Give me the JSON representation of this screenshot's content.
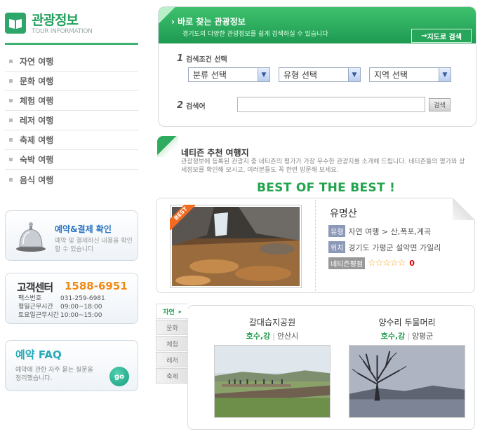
{
  "logo": {
    "title": "관광정보",
    "subtitle": "TOUR INFORMATION",
    "icon": "book-icon"
  },
  "side_menu": [
    {
      "label": "자연 여행"
    },
    {
      "label": "문화 여행"
    },
    {
      "label": "체험 여행"
    },
    {
      "label": "레저 여행"
    },
    {
      "label": "축제 여행"
    },
    {
      "label": "숙박 여행"
    },
    {
      "label": "음식 여행"
    }
  ],
  "reservation": {
    "title": "예약&결제 확인",
    "desc": "예약 및 결제하신 내용을 확인할 수 있습니다",
    "icon": "bell-icon"
  },
  "customer_center": {
    "title": "고객센터",
    "phone": "1588-6951",
    "lines": [
      {
        "key": "팩스번호",
        "value": "031-259-6981"
      },
      {
        "key": "평일근무시간",
        "value": "09:00~18:00"
      },
      {
        "key": "토요일근무시간",
        "value": "10:00~15:00"
      }
    ]
  },
  "faq": {
    "title": "예약 FAQ",
    "desc": "예약에 관한 자주 묻는 질문을 정리했습니다.",
    "go_label": "go"
  },
  "search": {
    "title": "바로 찾는 관광정보",
    "subtitle": "경기도의 다양한 관광정보를 쉽게 검색하실 수 있습니다",
    "map_button": "지도로 검색",
    "step1_num": "1",
    "step1_label": "검색조건 선택",
    "step2_num": "2",
    "step2_label": "검색어",
    "selects": [
      "분류 선택",
      "유형 선택",
      "지역 선택"
    ],
    "keyword_value": "",
    "search_button": "검색"
  },
  "recommend": {
    "title": "네티즌 추천 여행지",
    "desc": "관광정보에 등록된 관광지 중 네티즌의 평가가 가장 우수한 관광지를 소개해 드립니다. 네티즌들의 평가와 상세정보를 확인해 보시고, 여러분들도 꼭 한번 방문해 보세요."
  },
  "best": {
    "heading": "BEST OF THE BEST !",
    "badge": "BEST",
    "name": "유명산",
    "type_tag": "유형",
    "type_value": "자연 여행 > 산,폭포,계곡",
    "loc_tag": "위치",
    "loc_value": "경기도 가평군 설악면 가일리",
    "rating_tag": "네티즌평점",
    "stars": "☆☆☆☆☆",
    "score": "0",
    "star_color": "#f3a112"
  },
  "categories": {
    "tabs": [
      "자연",
      "문화",
      "체험",
      "레저",
      "축제"
    ],
    "active": "자연",
    "spots": [
      {
        "name": "갈대습지공원",
        "type": "호수,강",
        "region": "안산시"
      },
      {
        "name": "양수리 두물머리",
        "type": "호수,강",
        "region": "양평군"
      }
    ]
  },
  "colors": {
    "brand_green": "#23a05d",
    "accent_orange": "#f08a16",
    "faq_teal": "#27a9b8",
    "reserve_blue": "#2a74c2"
  }
}
